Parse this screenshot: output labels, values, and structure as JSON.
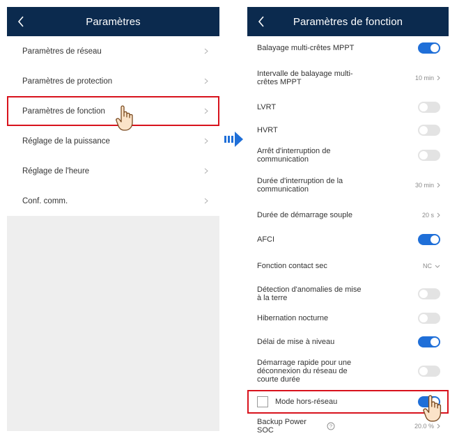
{
  "left_panel": {
    "title": "Paramètres",
    "items": [
      {
        "label": "Paramètres de réseau"
      },
      {
        "label": "Paramètres de protection"
      },
      {
        "label": "Paramètres de fonction"
      },
      {
        "label": "Réglage de la puissance"
      },
      {
        "label": "Réglage de l'heure"
      },
      {
        "label": "Conf. comm."
      }
    ]
  },
  "right_panel": {
    "title": "Paramètres de fonction",
    "rows": [
      {
        "label": "Balayage multi-crêtes MPPT",
        "control": "toggle",
        "state": "on"
      },
      {
        "label": "Intervalle de balayage multi-crêtes MPPT",
        "control": "value",
        "value": "10 min"
      },
      {
        "label": "LVRT",
        "control": "toggle",
        "state": "off"
      },
      {
        "label": "HVRT",
        "control": "toggle",
        "state": "off"
      },
      {
        "label": "Arrêt d'interruption de communication",
        "control": "toggle",
        "state": "off"
      },
      {
        "label": "Durée d'interruption de la communication",
        "control": "value",
        "value": "30 min"
      },
      {
        "label": "Durée de démarrage souple",
        "control": "value",
        "value": "20 s"
      },
      {
        "label": "AFCI",
        "control": "toggle",
        "state": "on"
      },
      {
        "label": "Fonction contact sec",
        "control": "dropdown",
        "value": "NC"
      },
      {
        "label": "Détection d'anomalies de mise à la terre",
        "control": "toggle",
        "state": "off"
      },
      {
        "label": "Hibernation nocturne",
        "control": "toggle",
        "state": "off"
      },
      {
        "label": "Délai de mise à niveau",
        "control": "toggle",
        "state": "on"
      },
      {
        "label": "Démarrage rapide pour une déconnexion du réseau de courte durée",
        "control": "toggle",
        "state": "off"
      },
      {
        "label": "Mode hors-réseau",
        "control": "toggle",
        "state": "on"
      },
      {
        "label": "Backup Power SOC",
        "control": "value",
        "value": "20.0 %"
      }
    ]
  },
  "icons": {
    "back": "chevron-left-icon",
    "chevron": "chevron-right-icon",
    "arrow": "right-arrow-icon",
    "hand": "pointing-hand-icon",
    "help": "question-circle-icon"
  },
  "colors": {
    "titlebar": "#0b2a4e",
    "toggle_on": "#1f6fd8",
    "highlight": "#d8121c"
  }
}
